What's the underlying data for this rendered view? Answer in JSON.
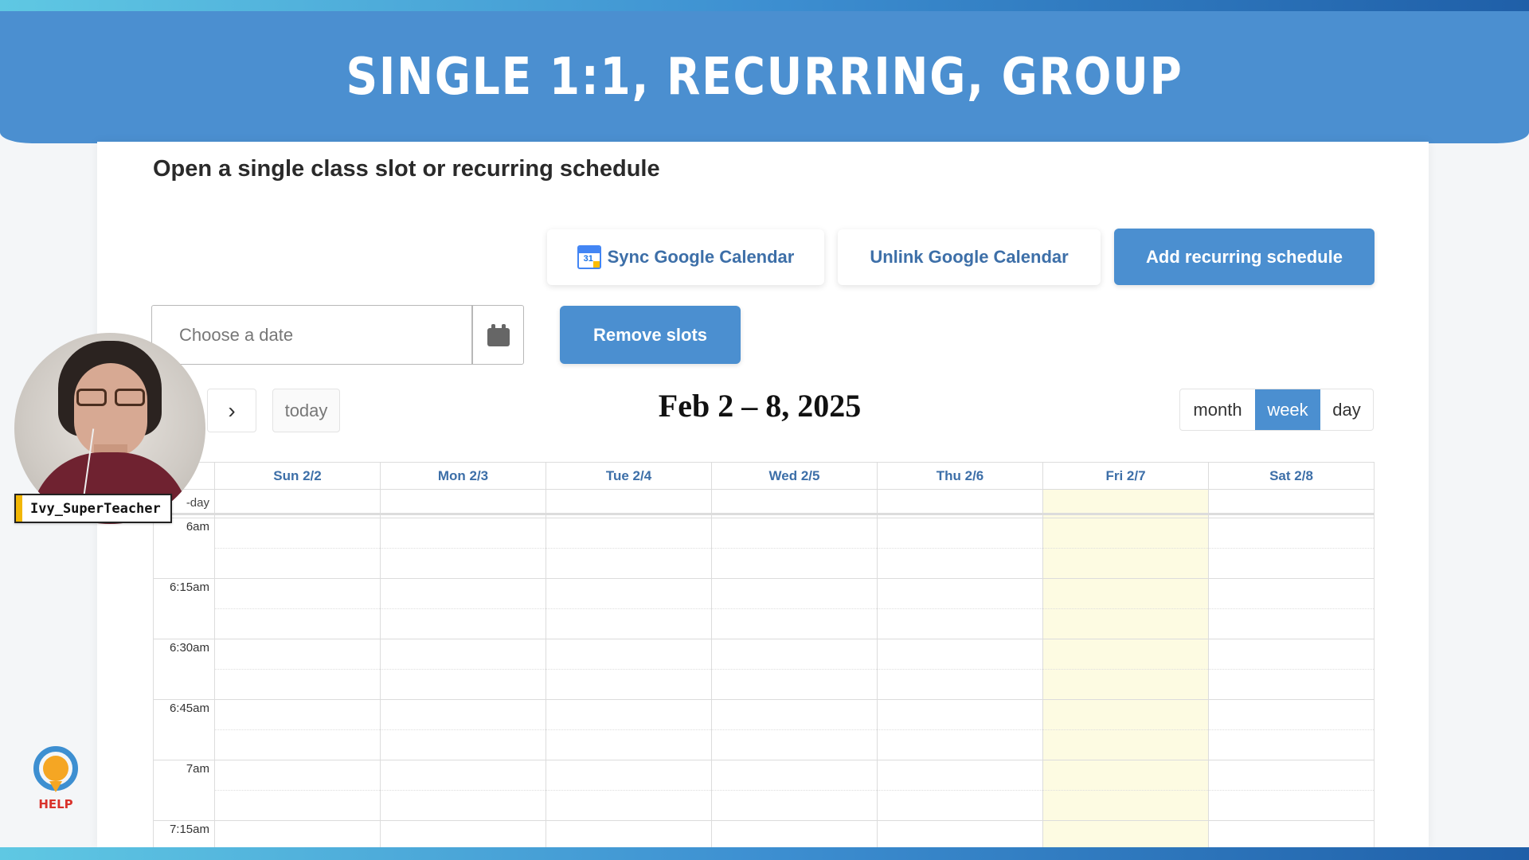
{
  "banner": {
    "title": "SINGLE 1:1, RECURRING, GROUP"
  },
  "section": {
    "title": "Open a single class slot or recurring schedule"
  },
  "toolbar": {
    "sync_label": "Sync Google Calendar",
    "sync_icon": "google-calendar-icon",
    "sync_icon_text": "31",
    "unlink_label": "Unlink Google Calendar",
    "add_recurring_label": "Add recurring schedule",
    "remove_slots_label": "Remove slots"
  },
  "date_picker": {
    "placeholder": "Choose a date",
    "value": "",
    "icon": "calendar-icon"
  },
  "navigation": {
    "next_icon": "chevron-right-icon",
    "next_glyph": "›",
    "today_label": "today"
  },
  "calendar": {
    "range_title": "Feb 2 – 8, 2025",
    "views": [
      {
        "label": "month",
        "active": false
      },
      {
        "label": "week",
        "active": true
      },
      {
        "label": "day",
        "active": false
      }
    ],
    "days": [
      "Sun 2/2",
      "Mon 2/3",
      "Tue 2/4",
      "Wed 2/5",
      "Thu 2/6",
      "Fri 2/7",
      "Sat 2/8"
    ],
    "today_index": 5,
    "allday_label": "-day",
    "time_slots": [
      "6am",
      "6:15am",
      "6:30am",
      "6:45am",
      "7am",
      "7:15am"
    ]
  },
  "presenter": {
    "name": "Ivy_SuperTeacher"
  },
  "help": {
    "label": "HELP",
    "icon": "help-headset-icon"
  },
  "colors": {
    "accent": "#4b8fd0",
    "link_text": "#3d6fa8",
    "today_highlight": "#fdfbe2",
    "help_red": "#d9322b"
  }
}
